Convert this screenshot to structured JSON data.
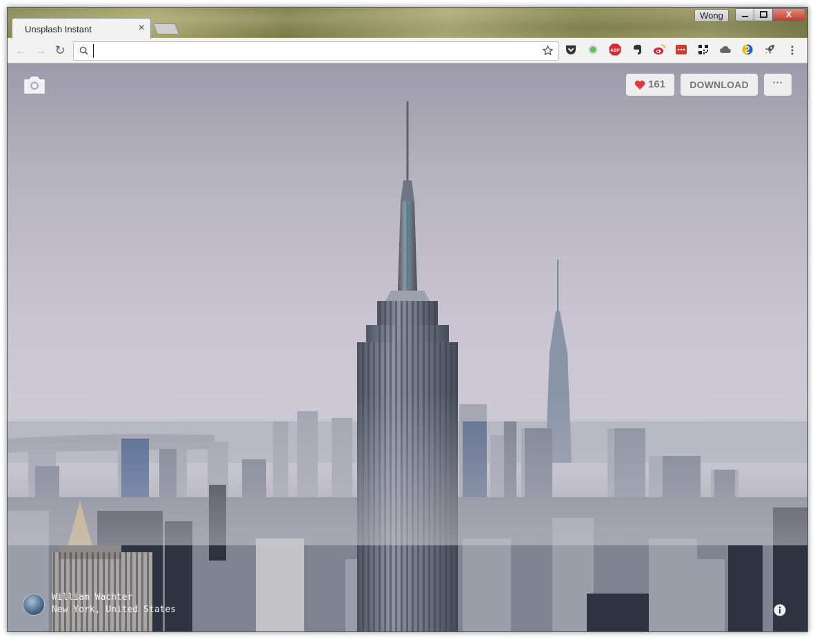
{
  "window": {
    "user_name": "Wong",
    "minimize_label": "minimize",
    "maximize_label": "maximize",
    "close_label": "X"
  },
  "tabs": [
    {
      "title": "Unsplash Instant",
      "active": true,
      "close_glyph": "×"
    }
  ],
  "toolbar": {
    "back_icon": "←",
    "forward_icon": "→",
    "reload_icon": "↻",
    "omnibox_value": "",
    "omnibox_placeholder": "",
    "extensions": [
      "pocket-icon",
      "green-dot-extension-icon",
      "adblock-plus-icon",
      "evernote-icon",
      "weibo-icon",
      "red-dots-extension-icon",
      "qr-code-icon",
      "cloud-icon",
      "colorful-s-extension-icon",
      "rocket-icon"
    ],
    "adblock_label": "ABP"
  },
  "photo": {
    "likes": "161",
    "download_label": "DOWNLOAD",
    "more_label": "···",
    "author": "William Wachter",
    "location": "New York, United States"
  },
  "colors": {
    "heart": "#e5383b",
    "button_bg": "#f2f2f2",
    "button_text": "#777777",
    "sky": "#c8c5d0"
  }
}
